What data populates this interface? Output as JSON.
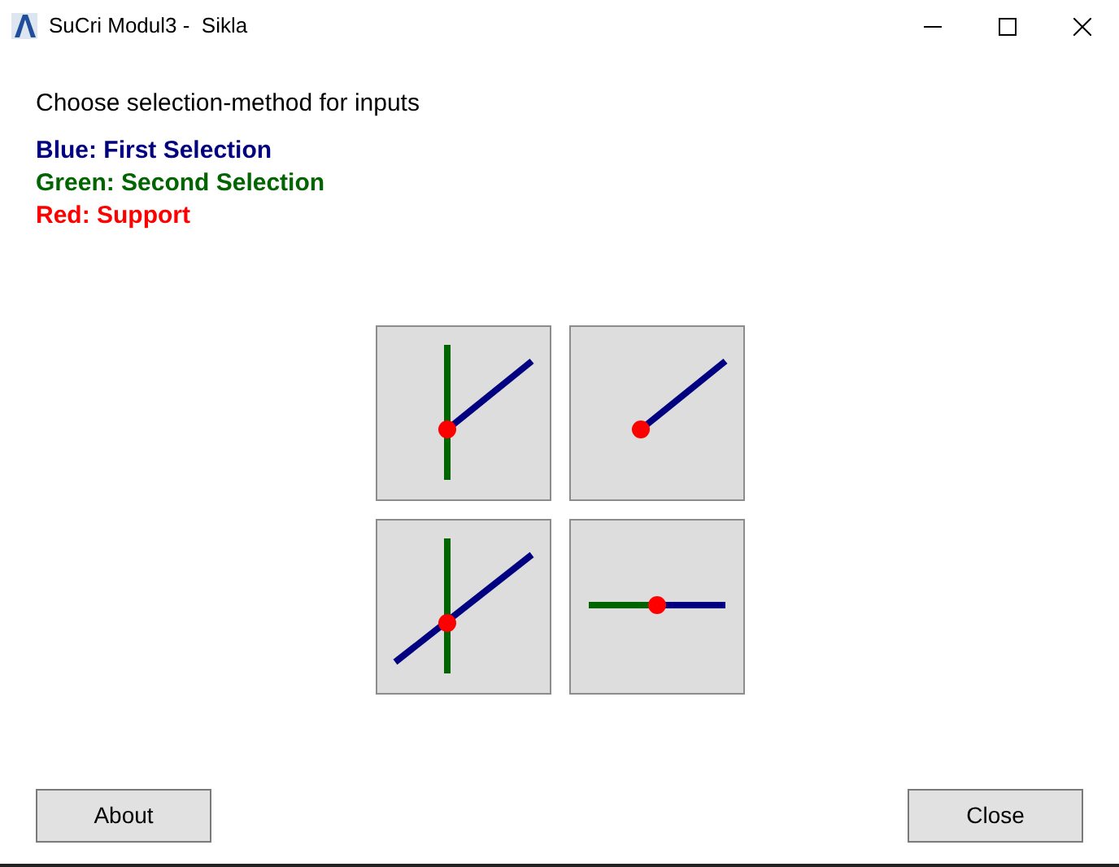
{
  "window": {
    "title": "SuCri Modul3 -  Sikla"
  },
  "instruction": "Choose selection-method for inputs",
  "legend": [
    {
      "label": "Blue: First Selection",
      "color": "#000080"
    },
    {
      "label": "Green: Second Selection",
      "color": "#006400"
    },
    {
      "label": "Red: Support",
      "color": "#ff0000"
    }
  ],
  "methods": [
    {
      "kind": "corner"
    },
    {
      "kind": "end"
    },
    {
      "kind": "cross"
    },
    {
      "kind": "inline"
    }
  ],
  "buttons": [
    {
      "label": "About"
    },
    {
      "label": "Close"
    }
  ]
}
